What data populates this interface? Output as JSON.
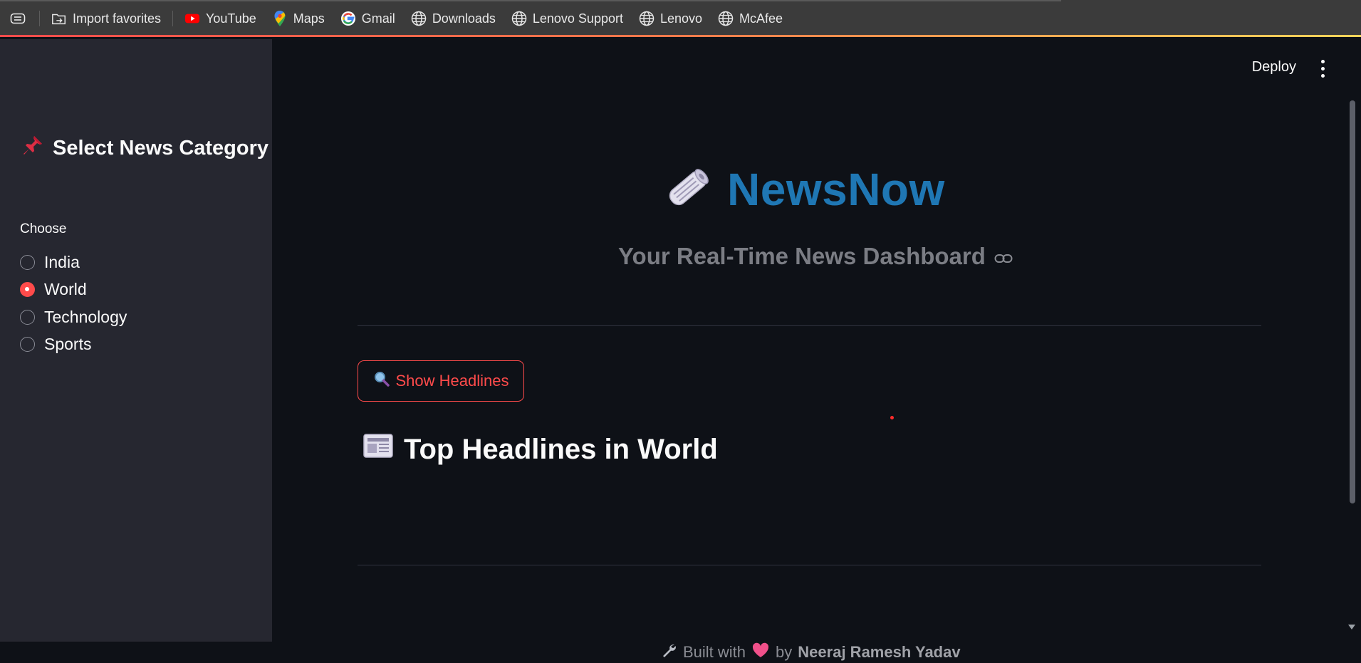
{
  "favorites_bar": {
    "items": [
      {
        "label": "Import favorites",
        "icon": "import-favorites-icon"
      },
      {
        "label": "YouTube",
        "icon": "youtube-icon"
      },
      {
        "label": "Maps",
        "icon": "maps-pin-icon"
      },
      {
        "label": "Gmail",
        "icon": "google-icon"
      },
      {
        "label": "Downloads",
        "icon": "globe-icon"
      },
      {
        "label": "Lenovo Support",
        "icon": "globe-icon"
      },
      {
        "label": "Lenovo",
        "icon": "globe-icon"
      },
      {
        "label": "McAfee",
        "icon": "globe-icon"
      }
    ]
  },
  "sidebar": {
    "title": "Select News Category",
    "title_icon": "pushpin-icon",
    "radio_label": "Choose",
    "options": [
      "India",
      "World",
      "Technology",
      "Sports"
    ],
    "selected": "World"
  },
  "header": {
    "deploy_label": "Deploy"
  },
  "main": {
    "app_title": "NewsNow",
    "app_icon": "rolled-newspaper-icon",
    "subtitle": "Your Real-Time News Dashboard",
    "button_label": "Show Headlines",
    "button_icon": "magnifier-icon",
    "section_heading": "Top Headlines in World",
    "section_icon": "newspaper-icon"
  },
  "footer": {
    "built_with": "Built with",
    "by": "by",
    "author": "Neeraj Ramesh Yadav"
  },
  "colors": {
    "accent": "#ff4b4b",
    "title_blue": "#1f77b4",
    "sidebar_bg": "#262730",
    "main_bg": "#0e1117"
  }
}
